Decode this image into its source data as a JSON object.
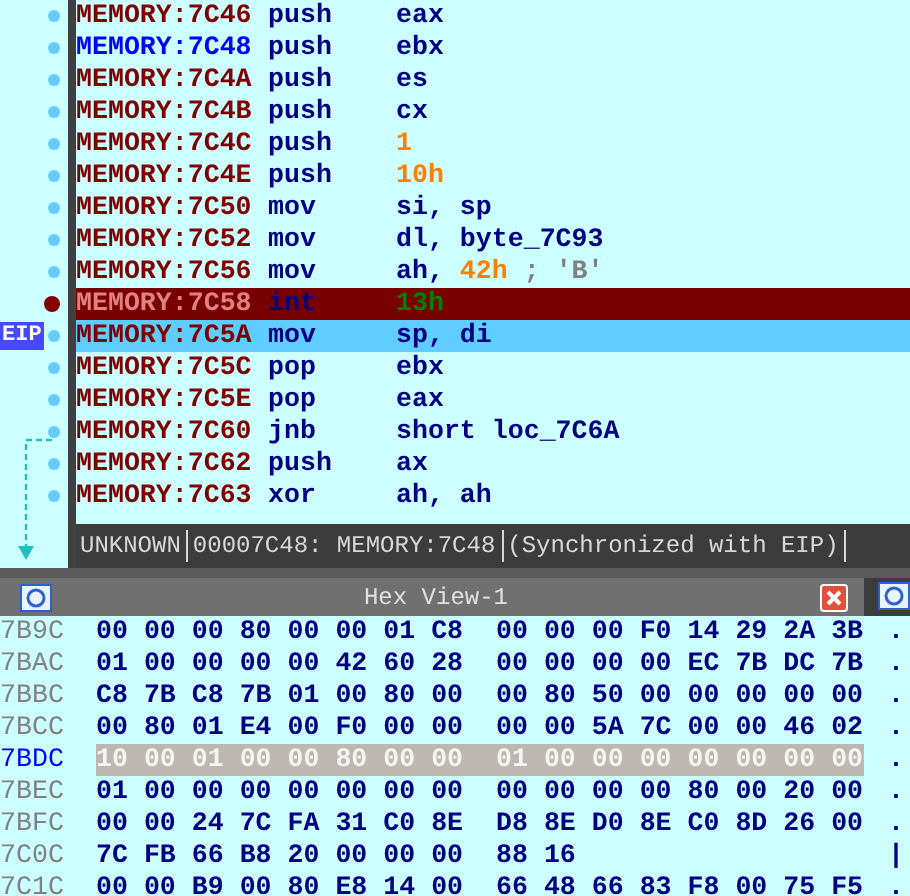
{
  "eip_label": "EIP",
  "disassembly": [
    {
      "address": "MEMORY:7C46",
      "mnemonic": "push",
      "operand": [
        {
          "text": "eax",
          "kind": "reg"
        }
      ],
      "breakpoint": false,
      "current": false,
      "synced": false
    },
    {
      "address": "MEMORY:7C48",
      "mnemonic": "push",
      "operand": [
        {
          "text": "ebx",
          "kind": "reg"
        }
      ],
      "breakpoint": false,
      "current": false,
      "synced": true
    },
    {
      "address": "MEMORY:7C4A",
      "mnemonic": "push",
      "operand": [
        {
          "text": "es",
          "kind": "reg"
        }
      ],
      "breakpoint": false,
      "current": false,
      "synced": false
    },
    {
      "address": "MEMORY:7C4B",
      "mnemonic": "push",
      "operand": [
        {
          "text": "cx",
          "kind": "reg"
        }
      ],
      "breakpoint": false,
      "current": false,
      "synced": false
    },
    {
      "address": "MEMORY:7C4C",
      "mnemonic": "push",
      "operand": [
        {
          "text": "1",
          "kind": "num"
        }
      ],
      "breakpoint": false,
      "current": false,
      "synced": false
    },
    {
      "address": "MEMORY:7C4E",
      "mnemonic": "push",
      "operand": [
        {
          "text": "10h",
          "kind": "num"
        }
      ],
      "breakpoint": false,
      "current": false,
      "synced": false
    },
    {
      "address": "MEMORY:7C50",
      "mnemonic": "mov",
      "operand": [
        {
          "text": "si, sp",
          "kind": "reg"
        }
      ],
      "breakpoint": false,
      "current": false,
      "synced": false
    },
    {
      "address": "MEMORY:7C52",
      "mnemonic": "mov",
      "operand": [
        {
          "text": "dl, byte_7C93",
          "kind": "reg"
        }
      ],
      "breakpoint": false,
      "current": false,
      "synced": false
    },
    {
      "address": "MEMORY:7C56",
      "mnemonic": "mov",
      "operand": [
        {
          "text": "ah, ",
          "kind": "reg"
        },
        {
          "text": "42h",
          "kind": "num"
        },
        {
          "text": " ; 'B'",
          "kind": "comment"
        }
      ],
      "breakpoint": false,
      "current": false,
      "synced": false
    },
    {
      "address": "MEMORY:7C58",
      "mnemonic": "int",
      "operand": [
        {
          "text": "13h",
          "kind": "num"
        }
      ],
      "breakpoint": true,
      "current": false,
      "synced": false
    },
    {
      "address": "MEMORY:7C5A",
      "mnemonic": "mov",
      "operand": [
        {
          "text": "sp, di",
          "kind": "reg"
        }
      ],
      "breakpoint": false,
      "current": true,
      "synced": false
    },
    {
      "address": "MEMORY:7C5C",
      "mnemonic": "pop",
      "operand": [
        {
          "text": "ebx",
          "kind": "reg"
        }
      ],
      "breakpoint": false,
      "current": false,
      "synced": false
    },
    {
      "address": "MEMORY:7C5E",
      "mnemonic": "pop",
      "operand": [
        {
          "text": "eax",
          "kind": "reg"
        }
      ],
      "breakpoint": false,
      "current": false,
      "synced": false
    },
    {
      "address": "MEMORY:7C60",
      "mnemonic": "jnb",
      "operand": [
        {
          "text": "short loc_7C6A",
          "kind": "reg"
        }
      ],
      "breakpoint": false,
      "current": false,
      "synced": false
    },
    {
      "address": "MEMORY:7C62",
      "mnemonic": "push",
      "operand": [
        {
          "text": "ax",
          "kind": "reg"
        }
      ],
      "breakpoint": false,
      "current": false,
      "synced": false
    },
    {
      "address": "MEMORY:7C63",
      "mnemonic": "xor",
      "operand": [
        {
          "text": "ah, ah",
          "kind": "reg"
        }
      ],
      "breakpoint": false,
      "current": false,
      "synced": false
    }
  ],
  "status_bar": [
    "UNKNOWN",
    "00007C48: MEMORY:7C48",
    "(Synchronized with EIP)"
  ],
  "hex_view": {
    "title": "Hex View-1",
    "rows": [
      {
        "address": "7B9C",
        "group_1": "00 00 00 80 00 00 01 C8",
        "group_2": "00 00 00 F0 14 29 2A 3B",
        "ascii": ".",
        "selected": false
      },
      {
        "address": "7BAC",
        "group_1": "01 00 00 00 00 42 60 28",
        "group_2": "00 00 00 00 EC 7B DC 7B",
        "ascii": ".",
        "selected": false
      },
      {
        "address": "7BBC",
        "group_1": "C8 7B C8 7B 01 00 80 00",
        "group_2": "00 80 50 00 00 00 00 00",
        "ascii": ".",
        "selected": false
      },
      {
        "address": "7BCC",
        "group_1": "00 80 01 E4 00 F0 00 00",
        "group_2": "00 00 5A 7C 00 00 46 02",
        "ascii": ".",
        "selected": false
      },
      {
        "address": "7BDC",
        "group_1": "10 00 01 00 00 80 00 00",
        "group_2": "01 00 00 00 00 00 00 00",
        "ascii": ".",
        "selected": true
      },
      {
        "address": "7BEC",
        "group_1": "01 00 00 00 00 00 00 00",
        "group_2": "00 00 00 00 80 00 20 00",
        "ascii": ".",
        "selected": false
      },
      {
        "address": "7BFC",
        "group_1": "00 00 24 7C FA 31 C0 8E",
        "group_2": "D8 8E D0 8E C0 8D 26 00",
        "ascii": ".",
        "selected": false
      },
      {
        "address": "7C0C",
        "group_1": "7C FB 66 B8 20 00 00 00",
        "group_2": "88 16",
        "ascii": "|",
        "selected": false
      },
      {
        "address": "7C1C",
        "group_1": "00 00 B9 00 80 E8 14 00",
        "group_2": "66 48 66 83 F8 00 75 F5",
        "ascii": ".",
        "selected": false
      }
    ]
  }
}
